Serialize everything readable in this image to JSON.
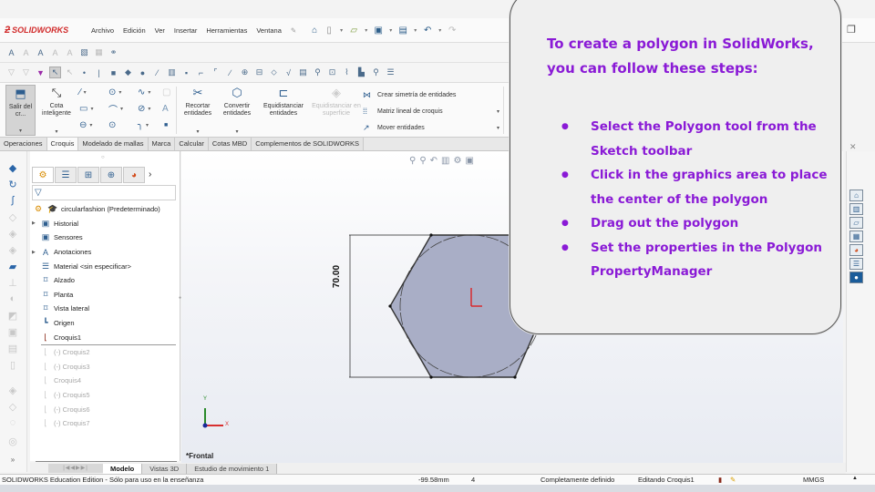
{
  "app": {
    "brand": "SOLIDWORKS",
    "menu": [
      "Archivo",
      "Edición",
      "Ver",
      "Insertar",
      "Herramientas",
      "Ventana"
    ]
  },
  "quick_access": [
    "home-icon",
    "new-doc-icon",
    "open-icon",
    "save-icon",
    "print-icon",
    "undo-icon",
    "redo-icon"
  ],
  "command_manager": {
    "exit_sketch": "Salir del cr...",
    "smart_dimension": "Cota inteligente",
    "trim": "Recortar entidades",
    "convert": "Convertir entidades",
    "offset": "Equidistanciar entidades",
    "offset_surface": "Equidistanciar en superficie",
    "mirror": "Crear simetría de entidades",
    "linear_pattern": "Matriz lineal de croquis",
    "move": "Mover entidades"
  },
  "tabs": [
    "Operaciones",
    "Croquis",
    "Modelado de mallas",
    "Marca",
    "Calcular",
    "Cotas MBD",
    "Complementos de SOLIDWORKS"
  ],
  "active_tab": "Croquis",
  "feature_tree": {
    "root": "circularfashion (Predeterminado)",
    "items": [
      {
        "label": "Historial",
        "icon": "history-folder-icon",
        "expandable": true,
        "faded": false
      },
      {
        "label": "Sensores",
        "icon": "sensor-folder-icon",
        "expandable": false,
        "faded": false
      },
      {
        "label": "Anotaciones",
        "icon": "annotations-folder-icon",
        "expandable": true,
        "faded": false
      },
      {
        "label": "Material <sin especificar>",
        "icon": "material-icon",
        "expandable": false,
        "faded": false
      },
      {
        "label": "Alzado",
        "icon": "plane-icon",
        "expandable": false,
        "faded": false
      },
      {
        "label": "Planta",
        "icon": "plane-icon",
        "expandable": false,
        "faded": false
      },
      {
        "label": "Vista lateral",
        "icon": "plane-icon",
        "expandable": false,
        "faded": false
      },
      {
        "label": "Origen",
        "icon": "origin-icon",
        "expandable": false,
        "faded": false
      },
      {
        "label": "Croquis1",
        "icon": "sketch-icon",
        "expandable": false,
        "faded": false
      },
      {
        "label": "(-) Croquis2",
        "icon": "sketch-icon",
        "expandable": false,
        "faded": true
      },
      {
        "label": "(-) Croquis3",
        "icon": "sketch-icon",
        "expandable": false,
        "faded": true
      },
      {
        "label": "Croquis4",
        "icon": "sketch-icon",
        "expandable": false,
        "faded": true
      },
      {
        "label": "(-) Croquis5",
        "icon": "sketch-icon",
        "expandable": false,
        "faded": true
      },
      {
        "label": "(-) Croquis6",
        "icon": "sketch-icon",
        "expandable": false,
        "faded": true
      },
      {
        "label": "(-) Croquis7",
        "icon": "sketch-icon",
        "expandable": false,
        "faded": true
      }
    ]
  },
  "graphics": {
    "dimension": "70.00",
    "view_label": "*Frontal",
    "axis_x": "X",
    "axis_y": "Y"
  },
  "bottom_tabs": [
    "Modelo",
    "Vistas 3D",
    "Estudio de movimiento 1"
  ],
  "status_bar": {
    "edition": "SOLIDWORKS Education Edition - Sólo para uso en la enseñanza",
    "coord": "-99.58mm",
    "value": "4",
    "definition": "Completamente definido",
    "editing": "Editando Croquis1",
    "units": "MMGS"
  },
  "callout": {
    "title": "To create a polygon in SolidWorks, you can follow these steps:",
    "steps": [
      "Select the Polygon tool from the Sketch toolbar",
      "Click in the graphics area to place the center of the polygon",
      "Drag out the polygon",
      "Set the properties in the Polygon PropertyManager"
    ],
    "color": "#8a1ad6"
  }
}
